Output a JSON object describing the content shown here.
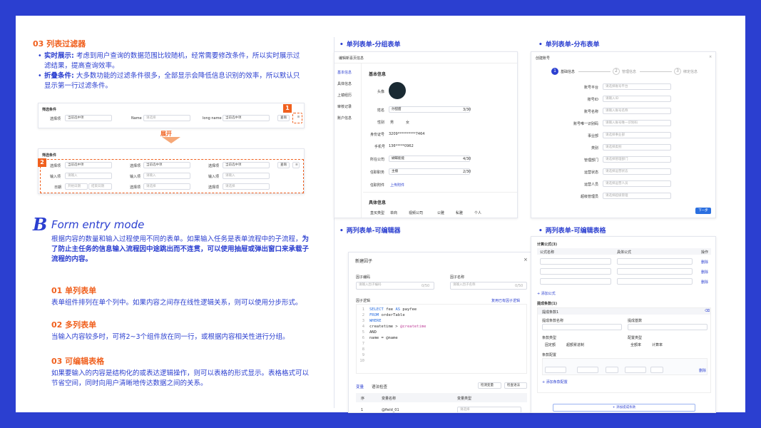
{
  "left": {
    "section_title": "03 列表过滤器",
    "bullets": [
      {
        "bold": "实时展示:",
        "text": "考虑到用户查询的数据范围比较随机，经常需要修改条件，所以实时展示过滤结果，提高查询效率。"
      },
      {
        "bold": "折叠条件:",
        "text": "大多数功能的过滤条件很多，全部显示会降低信息识别的效率，所以默认只显示第一行过滤条件。"
      }
    ],
    "filter1": {
      "title": "筛选条件",
      "label1": "选择项",
      "value1": "当前选中项",
      "label2": "Name",
      "ph2": "请选择",
      "label3": "long name",
      "value3": "当前选中项",
      "btn": "查询",
      "tag": "1"
    },
    "expand_label": "展开",
    "filter2": {
      "title": "筛选条件",
      "tag": "2",
      "row1": [
        "选择项",
        "当前选中项",
        "选择项",
        "当前选中项",
        "选择项",
        "当前选中项"
      ],
      "row2": [
        "输入项",
        "请输入",
        "输入项",
        "请输入",
        "输入项",
        "请输入"
      ],
      "row3": [
        "日期",
        "开始日期",
        "结束日期",
        "选择项",
        "请选择",
        "选择项",
        "请选择"
      ],
      "btn": "查询"
    },
    "big_letter": "B",
    "form_title": "Form entry mode",
    "form_desc_1": "根据内容的数量和输入过程使用不同的表单。如果输入任务是表单流程中的子流程，",
    "form_desc_bold": "为了防止主任务的信息输入流程因中途跳出而不连贯，可以使用抽屉或弹出窗口来承载子流程的内容。",
    "items": [
      {
        "title": "01 单列表单",
        "text": "表单组件排列在单个列中。如果内容之间存在线性逻辑关系，则可以使用分步形式。"
      },
      {
        "title": "02 多列表单",
        "text": "当输入内容较多时，可将2~3个组件放在同一行，或根据内容相关性进行分组。"
      },
      {
        "title": "03 可编辑表格",
        "text": "如果要输入的内容是结构化的或表达逻辑操作，则可以表格的形式显示。表格格式可以节省空间，同时向用户清晰地传达数据之间的关系。"
      }
    ]
  },
  "panels": {
    "p1": {
      "title": "单列表单-分组表单",
      "header": "编辑新喜页信息",
      "nav": [
        "基本信息",
        "具体信息",
        "上镜经历",
        "审核记录",
        "账户信息"
      ],
      "group1": "基本信息",
      "fields": [
        [
          "头像",
          ""
        ],
        [
          "姓名",
          "孙甜甜",
          "3/30"
        ],
        [
          "性别",
          "男",
          "女"
        ],
        [
          "身份证号",
          "3209**********7464"
        ],
        [
          "手机号",
          "136*****0962"
        ],
        [
          "所在公司",
          "蝴蝶能能",
          "4/30"
        ],
        [
          "任职职务",
          "主播",
          "2/30"
        ],
        [
          "任职附件",
          "上传附件"
        ]
      ],
      "group2": "具体信息",
      "last_label": "直买类型",
      "opts": [
        "单商",
        "视频公司",
        "公雅",
        "私雅",
        "个人"
      ]
    },
    "p2": {
      "title": "单列表单-分布表单",
      "header": "创建账号",
      "steps": [
        "基础信息",
        "管理信息",
        "绑定信息"
      ],
      "fields": [
        [
          "账号平台",
          "请选择账号平台"
        ],
        [
          "账号ID",
          "请输入ID"
        ],
        [
          "账号名称",
          "请输入账号名称"
        ],
        [
          "账号唯一识别码",
          "请输入账号唯一识别码"
        ],
        [
          "事业部",
          "请选择事业部"
        ],
        [
          "类别",
          "请选择类别"
        ],
        [
          "管理部门",
          "请选择管理部门"
        ],
        [
          "运营状态",
          "请选择运营状态"
        ],
        [
          "运营人员",
          "请选择运营人员"
        ],
        [
          "超级管理员",
          "请选择超级管理"
        ]
      ],
      "next": "下一步"
    },
    "p3": {
      "title": "两列表单-可编辑器",
      "header": "新建因子",
      "f1": "因子编码",
      "f1ph": "请输入因子编码",
      "f1c": "0/50",
      "f2": "因子名称",
      "f2ph": "请输入因子名称",
      "f2c": "0/50",
      "logic": "因子逻辑",
      "reuse": "复用已有因子逻辑",
      "code": [
        [
          "SELECT",
          "fee",
          "AS",
          "payfee"
        ],
        [
          "FROM",
          "orderTable"
        ],
        [
          "WHERE"
        ],
        [
          "createtime >",
          "@createtime"
        ],
        [
          "AND"
        ],
        [
          "name =",
          "@name"
        ]
      ],
      "tabs": [
        "变量",
        "语法检查"
      ],
      "btns": [
        "检测变量",
        "检查语法"
      ],
      "cols": [
        "序",
        "变量名称",
        "变量类型"
      ],
      "row": [
        "1",
        "@field_01",
        "请选择"
      ]
    },
    "p4": {
      "title": "两列表单-可编辑表格",
      "sec1": "计算公式(3)",
      "cols": [
        "公式名称",
        "具体公式",
        "操作"
      ],
      "add1": "+ 添加公式",
      "sec2": "提成条款(1)",
      "sub": "提成条款1",
      "labels": [
        "提成条款名称",
        "提成基数",
        "条款类型",
        "配置类型",
        "条款配置"
      ],
      "radios": [
        "固定额",
        "超额累进制",
        "全额率",
        "计算率"
      ],
      "add2": "+ 添加条款配置",
      "add3": "+ 添加提成条款",
      "del": "删除"
    }
  }
}
